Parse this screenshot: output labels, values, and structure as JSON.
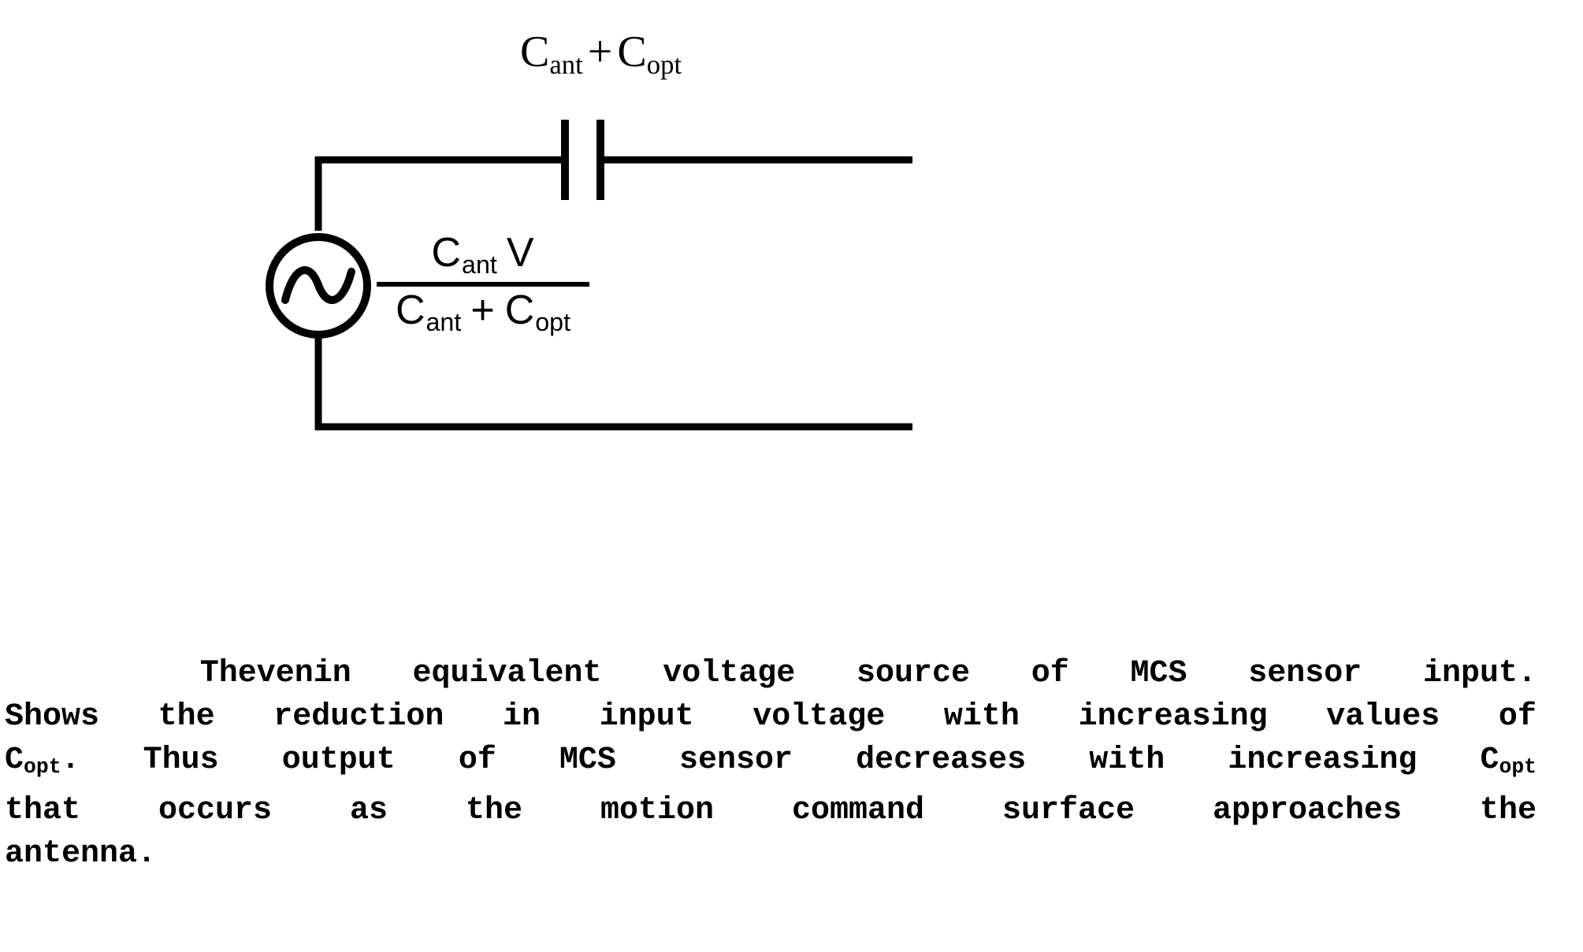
{
  "figure": {
    "capacitor_label": {
      "c1_base": "C",
      "c1_sub": "ant",
      "operator": "+",
      "c2_base": "C",
      "c2_sub": "opt"
    },
    "source": {
      "symbol_name": "ac-voltage-source",
      "waveform": "sine"
    },
    "fraction": {
      "numerator": {
        "base": "C",
        "sub": "ant",
        "variable": "V"
      },
      "denominator": {
        "c1_base": "C",
        "c1_sub": "ant",
        "operator": "+",
        "c2_base": "C",
        "c2_sub": "opt"
      }
    }
  },
  "caption": {
    "line1_words": [
      "Thevenin",
      "equivalent",
      "voltage",
      "source",
      "of",
      "MCS",
      "sensor",
      "input."
    ],
    "line2_words": [
      "Shows",
      "the",
      "reduction",
      "in",
      "input",
      "voltage",
      "with",
      "increasing",
      "values",
      "of"
    ],
    "line3_prefix_base": "C",
    "line3_prefix_sub": "opt",
    "line3_prefix_punct": ".",
    "line3_words": [
      "Thus",
      "output",
      "of",
      "MCS",
      "sensor",
      "decreases",
      "with",
      "increasing"
    ],
    "line3_suffix_base": "C",
    "line3_suffix_sub": "opt",
    "line4_words": [
      "that",
      "occurs",
      "as",
      "the",
      "motion",
      "command",
      "surface",
      "approaches",
      "the"
    ],
    "line5": "antenna."
  },
  "colors": {
    "ink": "#000000",
    "paper": "#ffffff"
  }
}
